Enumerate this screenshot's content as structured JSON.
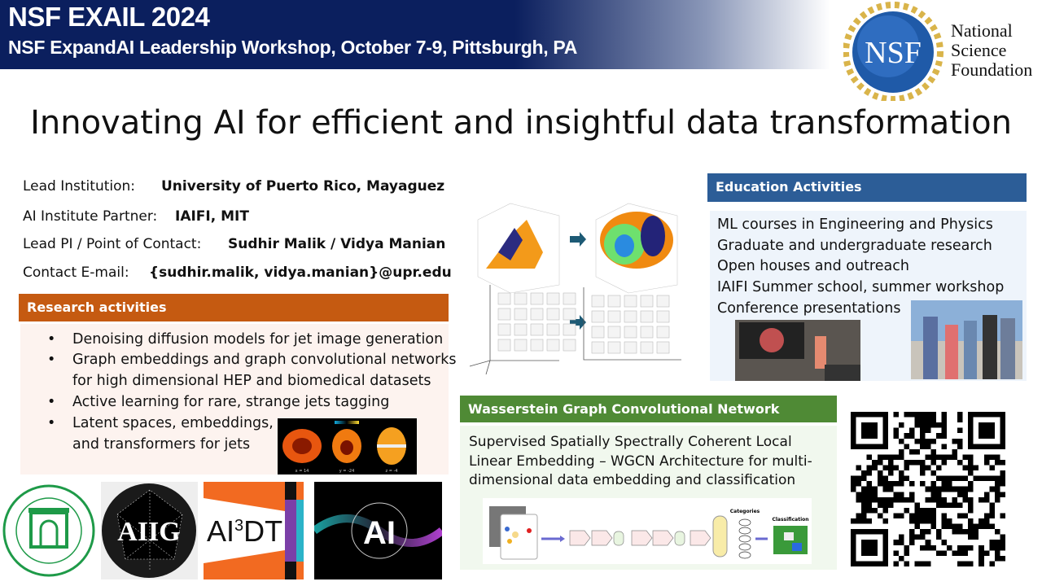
{
  "header": {
    "title": "NSF EXAIL 2024",
    "subtitle": "NSF ExpandAI Leadership Workshop, October 7-9, Pittsburgh, PA"
  },
  "nsf_logo": {
    "text": "NSF",
    "lines": [
      "National",
      "Science",
      "Foundation"
    ]
  },
  "title": "Innovating AI for efficient and insightful data transformation",
  "info": [
    {
      "label": "Lead Institution:",
      "value": "University of Puerto Rico, Mayaguez"
    },
    {
      "label": "AI Institute Partner:",
      "value": "IAIFI, MIT"
    },
    {
      "label": "Lead PI / Point of Contact:",
      "value": "Sudhir Malik / Vidya Manian"
    },
    {
      "label": "Contact E-mail:",
      "value": "{sudhir.malik, vidya.manian}@upr.edu"
    }
  ],
  "research": {
    "heading": "Research activities",
    "bullets": [
      "Denoising diffusion models for jet image generation",
      "Graph embeddings and graph convolutional networks",
      "for high dimensional HEP and biomedical datasets",
      "Active learning for rare, strange jets tagging",
      "Latent spaces, embeddings,",
      "and transformers for jets"
    ],
    "brain_labels": [
      "x = 14",
      "y = -24",
      "z = -4"
    ]
  },
  "logos": {
    "upr": "RECINTO UNIVERSITARIO DE MAYAGÜEZ",
    "aiig": "AIIG",
    "ai3dt": {
      "base": "AI",
      "sup": "3",
      "rest": "DT"
    },
    "ai": "AI"
  },
  "education": {
    "heading": "Education Activities",
    "items": [
      "ML courses in Engineering and Physics",
      "Graduate and undergraduate research",
      "Open houses and outreach",
      "IAIFI Summer school, summer workshop",
      "Conference presentations"
    ]
  },
  "wgcn": {
    "heading": "Wasserstein Graph Convolutional Network",
    "lines": [
      "Supervised Spatially Spectrally Coherent Local",
      "Linear Embedding – WGCN Architecture for multi-",
      "dimensional data embedding and classification"
    ],
    "diagram": {
      "categories": "Categories",
      "classification": "Classification"
    }
  },
  "colors": {
    "header": "#0b1f5e",
    "research": "#c55a11",
    "education": "#2c5d97",
    "wgcn": "#4f8a35"
  }
}
